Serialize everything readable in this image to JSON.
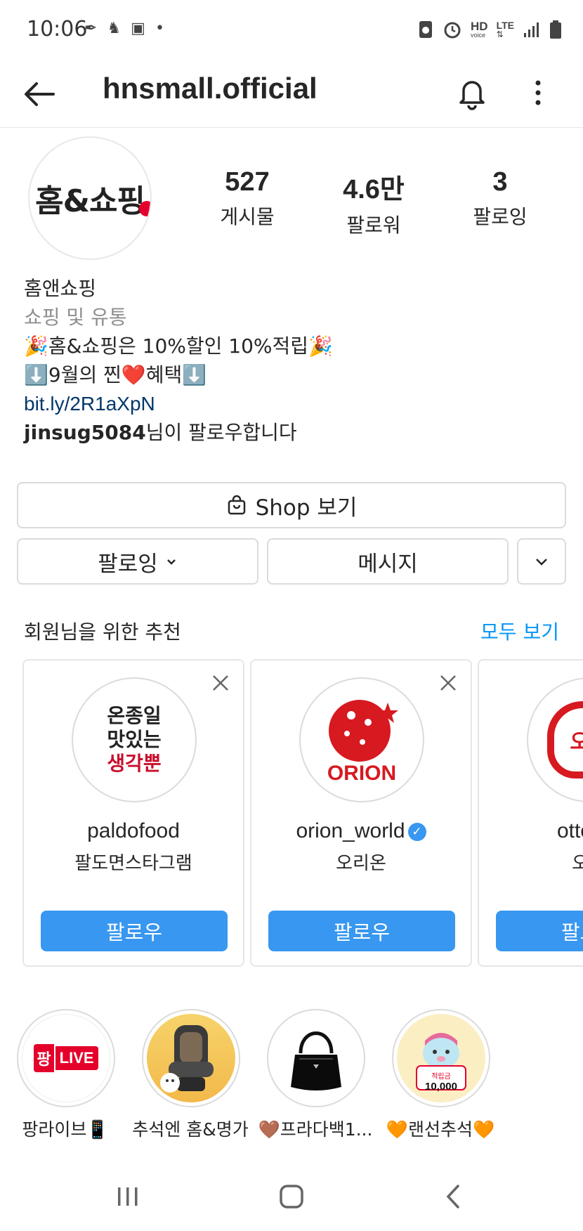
{
  "status_bar": {
    "time": "10:06",
    "right_labels": {
      "hd": "HD",
      "voice": "voice",
      "lte": "LTE"
    }
  },
  "header": {
    "username": "hnsmall.official"
  },
  "profile": {
    "avatar_text": "홈&쇼핑",
    "stats": [
      {
        "value": "527",
        "label": "게시물"
      },
      {
        "value": "4.6만",
        "label": "팔로워"
      },
      {
        "value": "3",
        "label": "팔로잉"
      }
    ],
    "bio": {
      "name": "홈앤쇼핑",
      "category": "쇼핑 및 유통",
      "line1": "🎉홈&쇼핑은 10%할인 10%적립🎉",
      "line2": "⬇️9월의 찐❤️혜택⬇️",
      "link": "bit.ly/2R1aXpN",
      "followed_by_name": "jinsug5084",
      "followed_by_text": "님이 팔로우합니다"
    }
  },
  "buttons": {
    "shop": "Shop 보기",
    "following": "팔로잉",
    "message": "메시지"
  },
  "suggestions": {
    "title": "회원님을 위한 추천",
    "see_all": "모두 보기",
    "follow_label": "팔로우",
    "cards": [
      {
        "username": "paldofood",
        "subtitle": "팔도면스타그램",
        "avatar_lines": [
          "온종일",
          "맛있는",
          "생각뿐"
        ]
      },
      {
        "username": "orion_world",
        "subtitle": "오리온",
        "avatar_text": "ORION",
        "verified": true
      },
      {
        "username": "ottogi_",
        "subtitle": "오뚜",
        "avatar_text": "오뚜"
      }
    ]
  },
  "highlights": [
    {
      "label": "팡라이브📱",
      "badge_left": "팡",
      "badge_right": "LIVE"
    },
    {
      "label": "추석엔 홈&명가"
    },
    {
      "label": "🤎프라다백1..."
    },
    {
      "label": "🧡랜선추석🧡",
      "badge_small": "적립금",
      "badge_value": "10,000"
    }
  ],
  "colors": {
    "accent": "#0095f6",
    "follow_button": "#3897f0",
    "brand_red": "#e4002b",
    "link": "#00376b"
  }
}
